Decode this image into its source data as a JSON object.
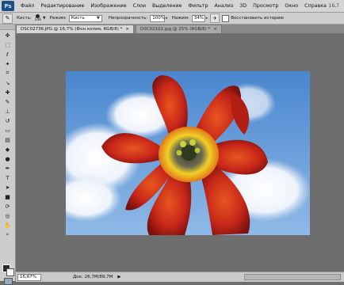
{
  "menubar": {
    "logo": "Ps",
    "items": [
      "Файл",
      "Редактирование",
      "Изображение",
      "Слои",
      "Выделение",
      "Фильтр",
      "Анализ",
      "3D",
      "Просмотр",
      "Окно",
      "Справка"
    ],
    "zoom": "16,7"
  },
  "options": {
    "brush_label": "Кисть:",
    "brush_size": "146",
    "mode_label": "Режим:",
    "mode_value": "Кисть",
    "opacity_label": "Непрозрачность:",
    "opacity_value": "100%",
    "pressure_label": "Нажим:",
    "pressure_value": "34%",
    "history_label": "Восстановить историю"
  },
  "tabs": [
    {
      "label": "DSC02736.JPG @ 16,7% (Фон копия, RGB/8) *",
      "close": "×"
    },
    {
      "label": "DSC02102.jpg @ 25% (RGB/8) *",
      "close": "×"
    }
  ],
  "status": {
    "zoom": "16,67%",
    "doc": "Док: 26,7M/89,7M",
    "arrow": "▶"
  },
  "icons": {
    "tools": [
      "move-icon",
      "marquee-icon",
      "lasso-icon",
      "magic-wand-icon",
      "crop-icon",
      "eyedropper-icon",
      "healing-icon",
      "brush-icon",
      "stamp-icon",
      "history-brush-icon",
      "eraser-icon",
      "gradient-icon",
      "blur-icon",
      "dodge-icon",
      "pen-icon",
      "type-icon",
      "path-select-icon",
      "shape-icon",
      "3d-rotate-icon",
      "3d-orbit-icon",
      "hand-icon",
      "zoom-icon"
    ]
  },
  "colors": {
    "menu_bg": "#d4d4d4",
    "canvas_bg": "#6e6e6e",
    "accent": "#1d4f84"
  }
}
